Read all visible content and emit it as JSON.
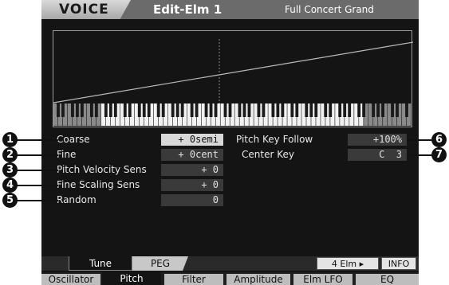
{
  "header": {
    "mode": "VOICE",
    "page": "Edit-Elm 1",
    "voice_name": "Full Concert Grand"
  },
  "params_left": [
    {
      "label": "Coarse",
      "value": "+ 0semi"
    },
    {
      "label": "Fine",
      "value": "+ 0cent"
    },
    {
      "label": "Pitch Velocity Sens",
      "value": "+ 0"
    },
    {
      "label": "Fine Scaling Sens",
      "value": "+ 0"
    },
    {
      "label": "Random",
      "value": "0"
    }
  ],
  "params_right": [
    {
      "label": "Pitch Key Follow",
      "value": "+100%"
    },
    {
      "label": "Center Key",
      "value": "C  3"
    }
  ],
  "callouts": [
    "1",
    "2",
    "3",
    "4",
    "5",
    "6",
    "7"
  ],
  "subtabs": {
    "tune": "Tune",
    "peg": "PEG"
  },
  "buttons": {
    "elm": "4 Elm ▸",
    "info": "INFO"
  },
  "main_tabs": [
    "Oscillator",
    "Pitch",
    "Filter",
    "Amplitude",
    "Elm LFO",
    "EQ"
  ],
  "colors": {
    "screen_bg": "#141414",
    "value_bg": "#3a3a3a",
    "selected_bg": "#d8d8d8"
  }
}
